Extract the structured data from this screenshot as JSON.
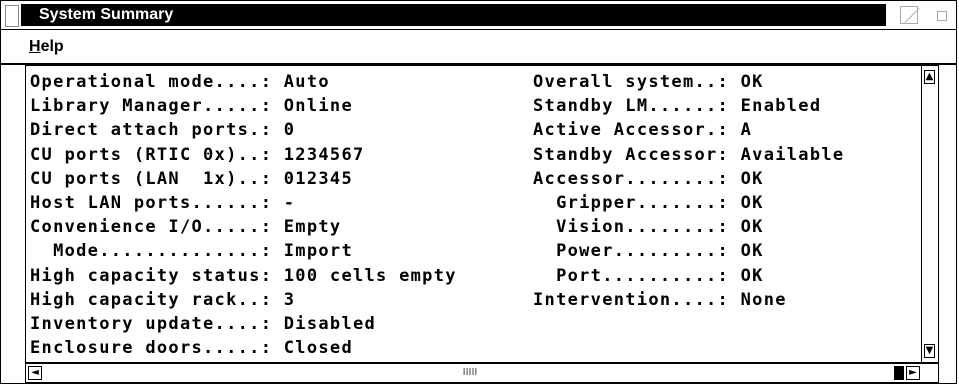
{
  "window": {
    "title": "System Summary"
  },
  "menu": {
    "help_underline": "H",
    "help_rest": "elp"
  },
  "summary": {
    "left": [
      "Operational mode....: Auto",
      "Library Manager.....: Online",
      "Direct attach ports.: 0",
      "CU ports (RTIC 0x)..: 1234567",
      "CU ports (LAN  1x)..: 012345",
      "Host LAN ports......: -",
      "Convenience I/O.....: Empty",
      "  Mode..............: Import",
      "High capacity status: 100 cells empty",
      "High capacity rack..: 3",
      "Inventory update....: Disabled",
      "Enclosure doors.....: Closed"
    ],
    "right": [
      "Overall system..: OK",
      "Standby LM......: Enabled",
      "Active Accessor.: A",
      "Standby Accessor: Available",
      "Accessor........: OK",
      "  Gripper.......: OK",
      "  Vision........: OK",
      "  Power.........: OK",
      "  Port..........: OK",
      "Intervention....: None"
    ]
  },
  "scrollbar": {
    "up_arrow": "▲",
    "down_arrow": "▼",
    "left_arrow": "◄",
    "right_arrow": "►",
    "thumb_grip": "IIIII"
  }
}
